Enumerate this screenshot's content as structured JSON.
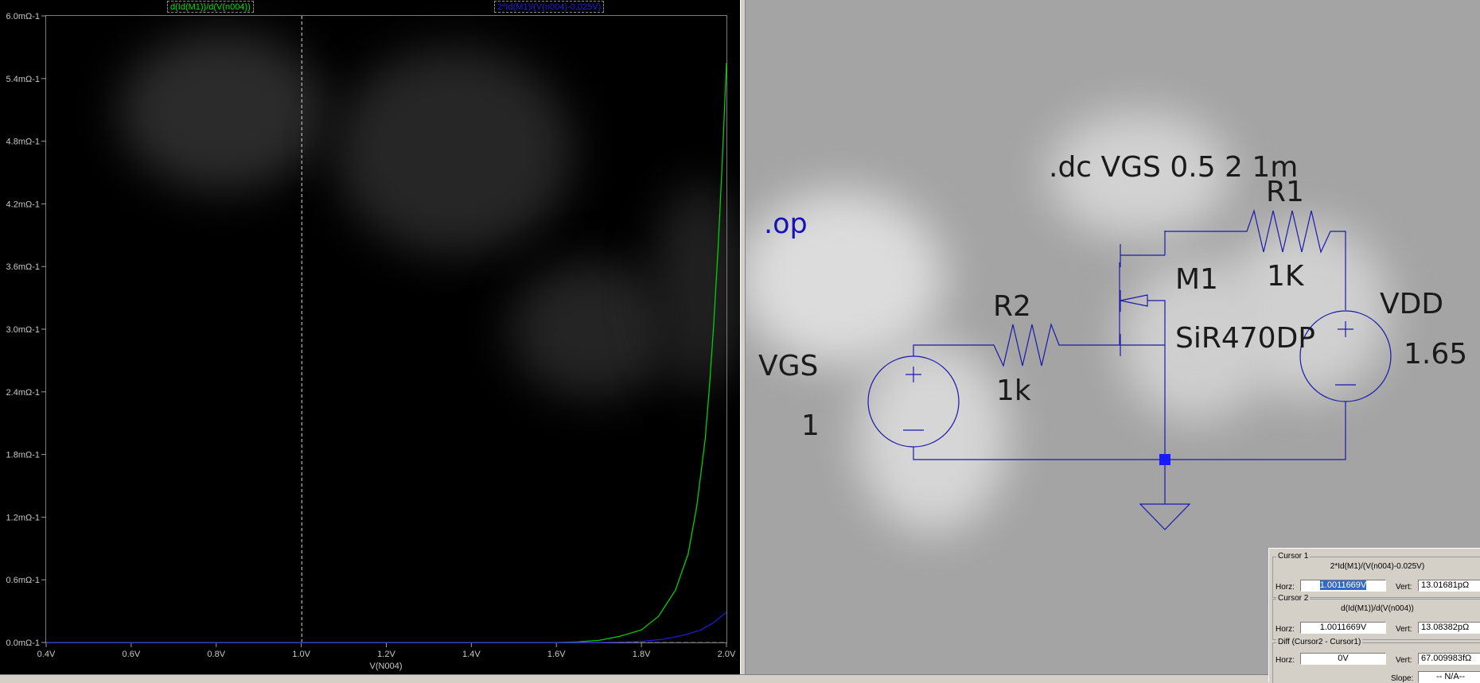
{
  "plot": {
    "traces": [
      {
        "label": "d(Id(M1))/d(V(n004))",
        "color": "#00d000"
      },
      {
        "label": "2*Id(M1)/(V(n004)-0.025V)",
        "color": "#1c1cd8"
      }
    ],
    "y_tick_labels": [
      "6.0mΩ-1",
      "5.4mΩ-1",
      "4.8mΩ-1",
      "4.2mΩ-1",
      "3.6mΩ-1",
      "3.0mΩ-1",
      "2.4mΩ-1",
      "1.8mΩ-1",
      "1.2mΩ-1",
      "0.6mΩ-1",
      "0.0mΩ-1"
    ],
    "x_tick_labels": [
      "0.4V",
      "0.6V",
      "0.8V",
      "1.0V",
      "1.2V",
      "1.4V",
      "1.6V",
      "1.8V",
      "2.0V"
    ],
    "x_axis_label": "V(N004)"
  },
  "chart_data": {
    "type": "line",
    "xlabel": "V(N004)",
    "ylabel": "",
    "xlim": [
      0.4,
      2.0
    ],
    "ylim": [
      0,
      6.0
    ],
    "grid": false,
    "cursor_x": 1.0011669,
    "series": [
      {
        "name": "d(Id(M1))/d(V(n004))",
        "color": "#00d000",
        "x": [
          1.6,
          1.65,
          1.7,
          1.75,
          1.8,
          1.84,
          1.88,
          1.91,
          1.93,
          1.95,
          1.96,
          1.97,
          1.98,
          1.99,
          2.0
        ],
        "y": [
          0.0,
          0.005,
          0.02,
          0.06,
          0.12,
          0.25,
          0.5,
          0.85,
          1.3,
          1.95,
          2.45,
          3.05,
          3.75,
          4.6,
          5.55
        ]
      },
      {
        "name": "2*Id(M1)/(V(n004)-0.025V)",
        "color": "#1c1cd8",
        "x": [
          1.7,
          1.8,
          1.85,
          1.9,
          1.94,
          1.97,
          2.0
        ],
        "y": [
          0.0,
          0.01,
          0.03,
          0.07,
          0.12,
          0.19,
          0.29
        ]
      }
    ]
  },
  "schematic": {
    "directive_dc": ".dc VGS 0.5 2 1m",
    "directive_op": ".op",
    "r1_name": "R1",
    "r1_value": "1K",
    "r2_name": "R2",
    "r2_value": "1k",
    "m1_name": "M1",
    "m1_model": "SiR470DP",
    "vdd_name": "VDD",
    "vdd_value": "1.65",
    "vgs_name": "VGS",
    "vgs_value": "1",
    "wire_color": "#1a1aa8",
    "op_color": "#1414b8"
  },
  "cursor_panel": {
    "cursor1": {
      "title": "Cursor 1",
      "expr": "2*Id(M1)/(V(n004)-0.025V)",
      "horz_label": "Horz:",
      "horz": "1.0011669V",
      "vert_label": "Vert:",
      "vert": "13.01681pΩ"
    },
    "cursor2": {
      "title": "Cursor 2",
      "expr": "d(Id(M1))/d(V(n004))",
      "horz_label": "Horz:",
      "horz": "1.0011669V",
      "vert_label": "Vert:",
      "vert": "13.08382pΩ"
    },
    "diff": {
      "title": "Diff (Cursor2 - Cursor1)",
      "horz_label": "Horz:",
      "horz": "0V",
      "vert_label": "Vert:",
      "vert": "67.009983fΩ",
      "slope_label": "Slope:",
      "slope": "-- N/A--"
    }
  }
}
